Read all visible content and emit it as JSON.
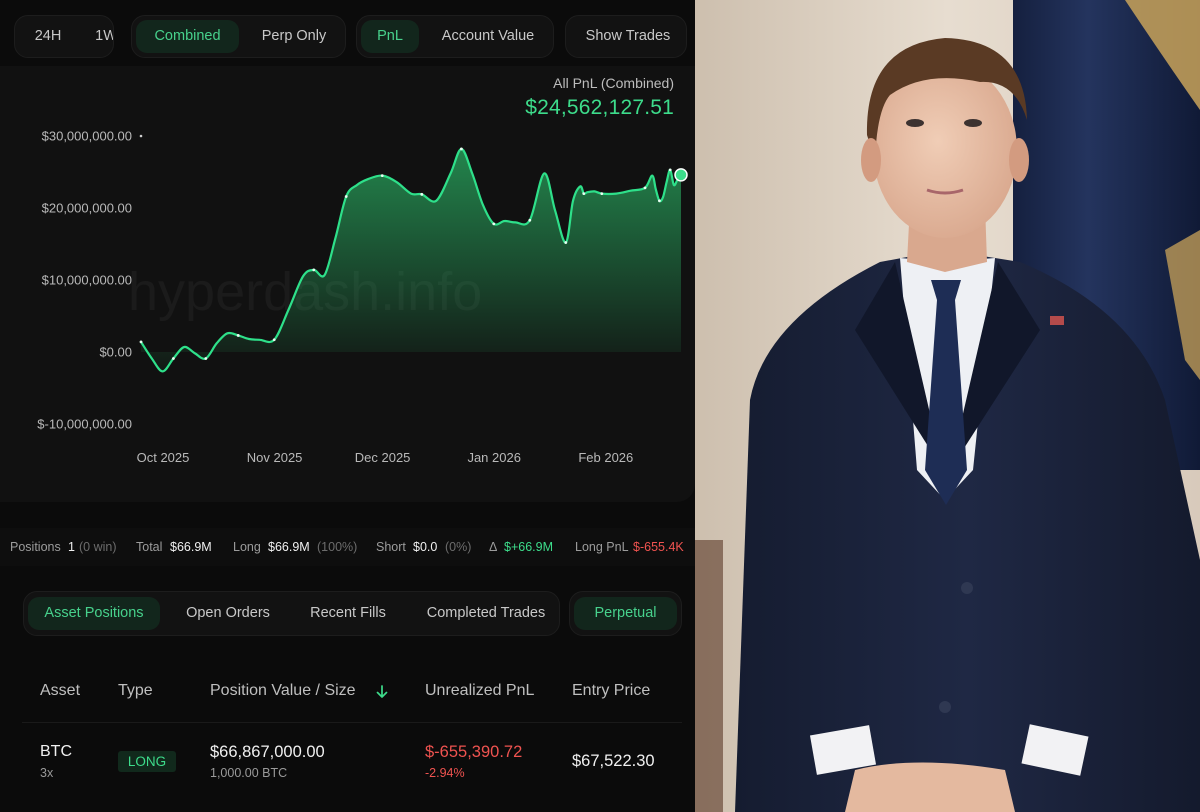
{
  "toolbar": {
    "range_group": [
      "24H",
      "1W"
    ],
    "mode_group": {
      "options": [
        "Combined",
        "Perp Only"
      ],
      "selected": "Combined"
    },
    "metric_group": {
      "options": [
        "PnL",
        "Account Value"
      ],
      "selected": "PnL"
    },
    "show_trades": "Show Trades"
  },
  "pnl_summary": {
    "label": "All PnL (Combined)",
    "value": "$24,562,127.51"
  },
  "watermark": "hyperdash.info",
  "chart_data": {
    "type": "area",
    "title": "All PnL (Combined)",
    "xlabel": "",
    "ylabel": "",
    "ylim": [
      -10000000,
      30000000
    ],
    "y_ticks": [
      "$30,000,000.00",
      "$20,000,000.00",
      "$10,000,000.00",
      "$0.00",
      "$-10,000,000.00"
    ],
    "y_tick_values": [
      30000000,
      20000000,
      10000000,
      0,
      -10000000
    ],
    "x_ticks": [
      {
        "label": "Oct 2025",
        "date": "2025-10-01"
      },
      {
        "label": "Nov 2025",
        "date": "2025-11-01"
      },
      {
        "label": "Dec 2025",
        "date": "2025-12-01"
      },
      {
        "label": "Jan 2026",
        "date": "2026-01-01"
      },
      {
        "label": "Feb 2026",
        "date": "2026-02-01"
      }
    ],
    "xlim": [
      "2025-10-01",
      "2026-02-28"
    ],
    "color": "#2ecc71",
    "series": [
      {
        "name": "PnL (Combined)",
        "x": [
          "2025-10-01",
          "2025-10-04",
          "2025-10-07",
          "2025-10-10",
          "2025-10-13",
          "2025-10-16",
          "2025-10-19",
          "2025-10-22",
          "2025-10-25",
          "2025-10-28",
          "2025-10-31",
          "2025-11-03",
          "2025-11-07",
          "2025-11-11",
          "2025-11-15",
          "2025-11-18",
          "2025-11-21",
          "2025-11-24",
          "2025-11-27",
          "2025-11-30",
          "2025-12-03",
          "2025-12-07",
          "2025-12-11",
          "2025-12-15",
          "2025-12-18",
          "2025-12-22",
          "2025-12-26",
          "2025-12-29",
          "2026-01-01",
          "2026-01-04",
          "2026-01-07",
          "2026-01-10",
          "2026-01-13",
          "2026-01-17",
          "2026-01-21",
          "2026-01-24",
          "2026-01-27",
          "2026-01-29",
          "2026-01-31",
          "2026-02-01",
          "2026-02-02",
          "2026-02-04",
          "2026-02-06",
          "2026-02-10",
          "2026-02-14",
          "2026-02-18",
          "2026-02-20",
          "2026-02-21",
          "2026-02-22",
          "2026-02-23",
          "2026-02-24",
          "2026-02-25",
          "2026-02-26",
          "2026-02-27",
          "2026-02-28"
        ],
        "y": [
          1400000,
          -900000,
          -2700000,
          -900000,
          700000,
          -200000,
          -900000,
          1200000,
          2600000,
          2300000,
          1800000,
          1700000,
          1700000,
          5900000,
          10500000,
          11400000,
          10700000,
          15800000,
          21600000,
          23200000,
          24000000,
          24500000,
          23600000,
          22000000,
          21900000,
          21000000,
          24800000,
          28200000,
          24800000,
          20400000,
          17800000,
          18200000,
          18000000,
          18300000,
          24800000,
          19700000,
          15200000,
          21000000,
          23000000,
          22000000,
          22200000,
          22300000,
          22000000,
          22000000,
          22400000,
          22800000,
          24500000,
          22600000,
          21000000,
          21500000,
          23600000,
          25300000,
          23200000,
          23900000,
          24600000
        ]
      }
    ]
  },
  "stats": {
    "positions_label": "Positions",
    "positions_value": "1",
    "positions_win": "(0 win)",
    "total_label": "Total",
    "total_value": "$66.9M",
    "long_label": "Long",
    "long_value": "$66.9M",
    "long_pct": "(100%)",
    "short_label": "Short",
    "short_value": "$0.0",
    "short_pct": "(0%)",
    "delta_label": "Δ",
    "delta_value": "$+66.9M",
    "long_pnl_label": "Long PnL",
    "long_pnl_value": "$-655.4K"
  },
  "tabs": {
    "items": [
      "Asset Positions",
      "Open Orders",
      "Recent Fills",
      "Completed Trades"
    ],
    "selected": "Asset Positions",
    "filter": "Perpetual"
  },
  "table": {
    "headers": [
      "Asset",
      "Type",
      "Position Value / Size",
      "Unrealized PnL",
      "Entry Price"
    ],
    "sort_icon": "arrow-down-icon",
    "rows": [
      {
        "asset": "BTC",
        "leverage": "3x",
        "type": "LONG",
        "position_value": "$66,867,000.00",
        "size": "1,000.00 BTC",
        "unrealized_pnl": "$-655,390.72",
        "unrealized_pct": "-2.94%",
        "entry_price": "$67,522.30"
      }
    ]
  },
  "colors": {
    "accent_green": "#3ddc8b",
    "loss_red": "#ef5350",
    "background": "#0b0b0b",
    "panel": "#111111"
  }
}
